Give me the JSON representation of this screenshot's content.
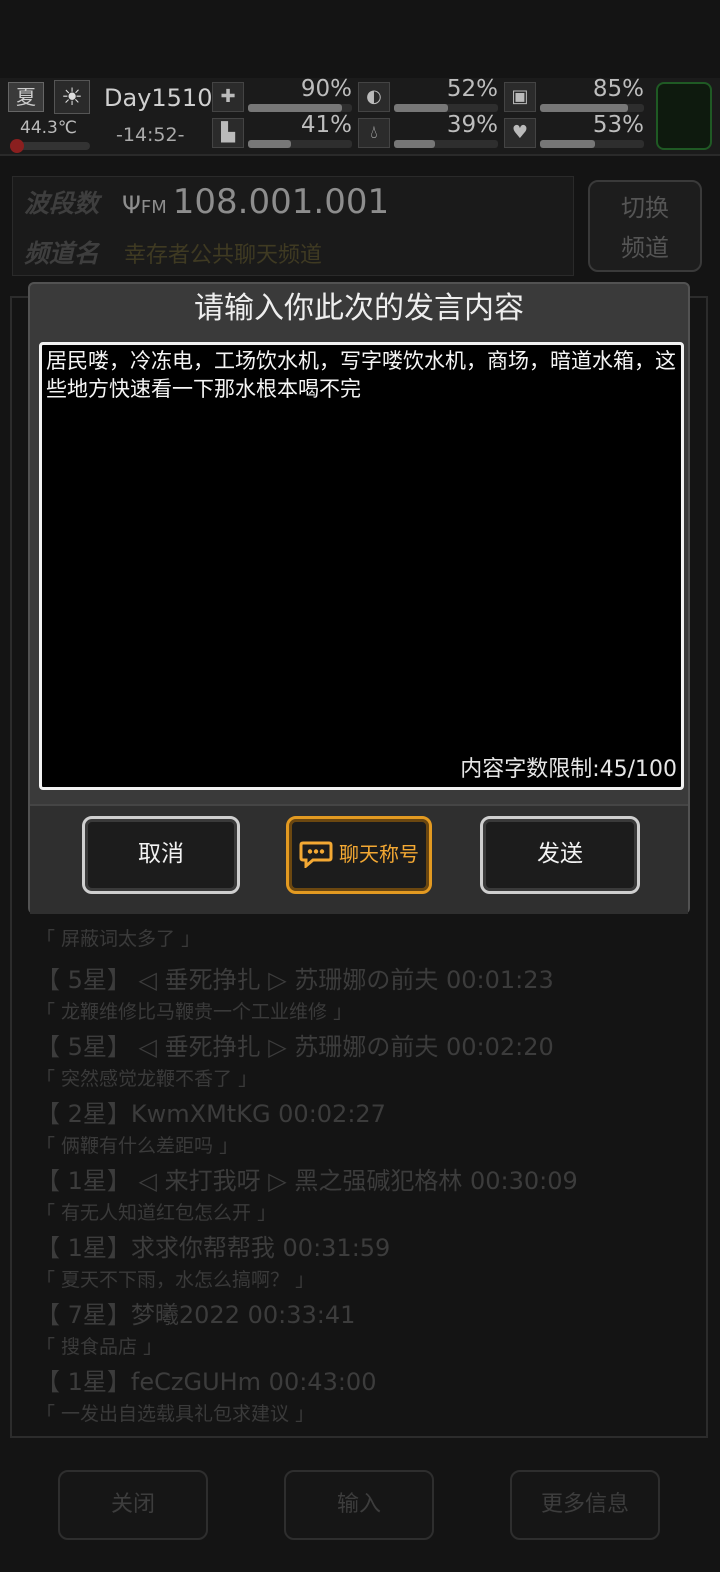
{
  "hud": {
    "season": "夏",
    "temperature": "44.3℃",
    "day": "Day1510",
    "clock": "-14:52-",
    "stats": [
      {
        "icon": "medkit-icon",
        "value": "90%",
        "fill": 0.9
      },
      {
        "icon": "stomach-icon",
        "value": "52%",
        "fill": 0.52
      },
      {
        "icon": "stamina-icon",
        "value": "85%",
        "fill": 0.85
      },
      {
        "icon": "boot-icon",
        "value": "41%",
        "fill": 0.41
      },
      {
        "icon": "water-drop-icon",
        "value": "39%",
        "fill": 0.39
      },
      {
        "icon": "heart-icon",
        "value": "53%",
        "fill": 0.53
      }
    ]
  },
  "radio": {
    "band_label": "波段数",
    "channel_label": "频道名",
    "fm": "FM",
    "frequency": "108.001.001",
    "channel_name": "幸存者公共聊天频道",
    "switch_label_1": "切换",
    "switch_label_2": "频道"
  },
  "chat": [
    {
      "head": "",
      "body": "「 屏蔽词太多了 」"
    },
    {
      "head": "【 5星】 ◁ 垂死挣扎 ▷ 苏珊娜の前夫 00:01:23",
      "body": "「 龙鞭维修比马鞭贵一个工业维修 」"
    },
    {
      "head": "【 5星】 ◁ 垂死挣扎 ▷ 苏珊娜の前夫 00:02:20",
      "body": "「 突然感觉龙鞭不香了 」"
    },
    {
      "head": "【 2星】KwmXMtKG 00:02:27",
      "body": "「 俩鞭有什么差距吗 」"
    },
    {
      "head": "【 1星】 ◁ 来打我呀 ▷ 黑之强碱犯格林 00:30:09",
      "body": "「 有无人知道红包怎么开 」"
    },
    {
      "head": "【 1星】求求你帮帮我 00:31:59",
      "body": "「 夏天不下雨，水怎么搞啊？ 」"
    },
    {
      "head": "【 7星】梦曦2022 00:33:41",
      "body": "「 搜食品店 」"
    },
    {
      "head": "【 1星】feCzGUHm 00:43:00",
      "body": "「 一发出自选载具礼包求建议 」"
    }
  ],
  "bottom": {
    "close": "关闭",
    "input": "输入",
    "more": "更多信息"
  },
  "dialog": {
    "title": "请输入你此次的发言内容",
    "content": "居民喽，冷冻电，工场饮水机，写字喽饮水机，商场，暗道水箱，这些地方快速看一下那水根本喝不完",
    "limit": "内容字数限制:45/100",
    "cancel": "取消",
    "chat_title": "聊天称号",
    "send": "发送"
  },
  "colors": {
    "accent_orange": "#f3a833",
    "dialog_bg": "#3a3a3a"
  }
}
